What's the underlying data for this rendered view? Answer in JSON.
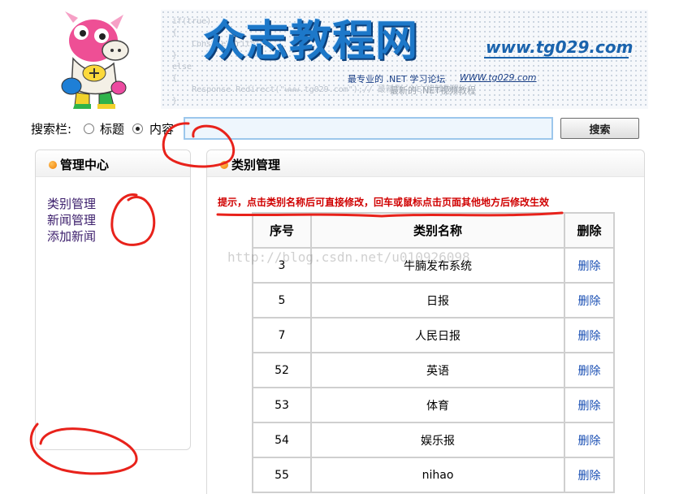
{
  "banner": {
    "title": "众志教程网",
    "url_big": "www.tg029.com",
    "slogan": "最专业的 .NET 学习论坛",
    "url_small": "WWW.tg029.com",
    "slogan2": "最新的 .NET视频教程",
    "code_text": "if(true)\n{\n    Console.Write(\n}\nelse\n{\n    Response.Redirect(\"www.tg029.com\");// 最新的 .NET视频教程\n}"
  },
  "search": {
    "label": "搜索栏:",
    "option_title": "标题",
    "option_content": "内容",
    "selected": "内容",
    "input_value": "",
    "button_label": "搜索"
  },
  "sidebar": {
    "title": "管理中心",
    "items": [
      {
        "label": "类别管理"
      },
      {
        "label": "新闻管理"
      },
      {
        "label": "添加新闻"
      }
    ]
  },
  "main": {
    "title": "类别管理",
    "hint": "提示，点击类别名称后可直接修改，回车或鼠标点击页面其他地方后修改生效",
    "columns": [
      "序号",
      "类别名称",
      "删除"
    ],
    "rows": [
      {
        "id": "3",
        "name": "牛腩发布系统",
        "action": "删除"
      },
      {
        "id": "5",
        "name": "日报",
        "action": "删除"
      },
      {
        "id": "7",
        "name": "人民日报",
        "action": "删除"
      },
      {
        "id": "52",
        "name": "英语",
        "action": "删除"
      },
      {
        "id": "53",
        "name": "体育",
        "action": "删除"
      },
      {
        "id": "54",
        "name": "娱乐报",
        "action": "删除"
      },
      {
        "id": "55",
        "name": "nihao",
        "action": "删除"
      }
    ]
  },
  "watermark": "http://blog.csdn.net/u010926098",
  "colors": {
    "link": "#1a4fb3",
    "hint": "#d00000",
    "annotation": "#e8221b",
    "title_blue": "#1d78c9"
  }
}
